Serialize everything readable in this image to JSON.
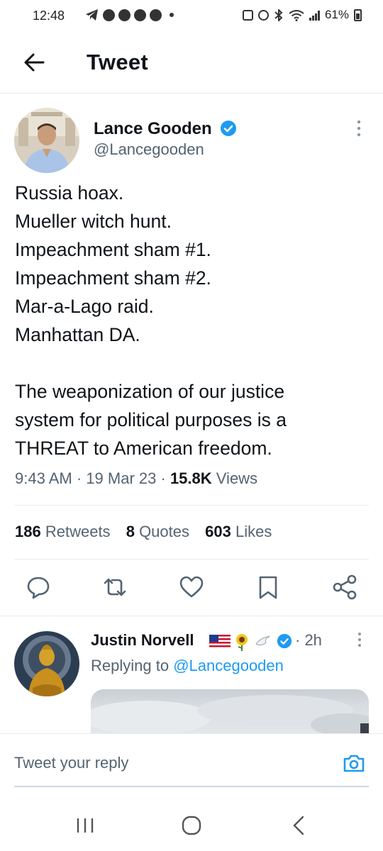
{
  "status_bar": {
    "time": "12:48",
    "battery": "61%"
  },
  "header": {
    "title": "Tweet"
  },
  "tweet": {
    "author_name": "Lance Gooden",
    "author_handle": "@Lancegooden",
    "lines": [
      "Russia hoax.",
      "Mueller witch hunt.",
      "Impeachment sham #1.",
      "Impeachment sham #2.",
      "Mar-a-Lago raid.",
      "Manhattan DA."
    ],
    "paragraph_lines": [
      "The weaponization of our justice",
      "system for political purposes is a",
      "THREAT to American freedom."
    ],
    "time": "9:43 AM",
    "date": "19 Mar 23",
    "views_count": "15.8K",
    "views_label": "Views",
    "separator": "·"
  },
  "stats": {
    "retweets_count": "186",
    "retweets_label": "Retweets",
    "quotes_count": "8",
    "quotes_label": "Quotes",
    "likes_count": "603",
    "likes_label": "Likes"
  },
  "reply": {
    "author_name": "Justin Norvell",
    "time": "· 2h",
    "replying_prefix": "Replying to",
    "replying_to": "@Lancegooden"
  },
  "composer": {
    "placeholder": "Tweet your reply"
  },
  "colors": {
    "accent": "#1d9bf0",
    "text": "#0f1419",
    "secondary": "#536471",
    "border": "#e6ecf0"
  },
  "icons": {
    "back": "arrow-left-icon",
    "verified": "verified-badge-icon",
    "more": "more-vertical-icon",
    "reply": "reply-icon",
    "retweet": "retweet-icon",
    "like": "heart-icon",
    "bookmark": "bookmark-icon",
    "share": "share-icon",
    "camera": "camera-icon"
  }
}
